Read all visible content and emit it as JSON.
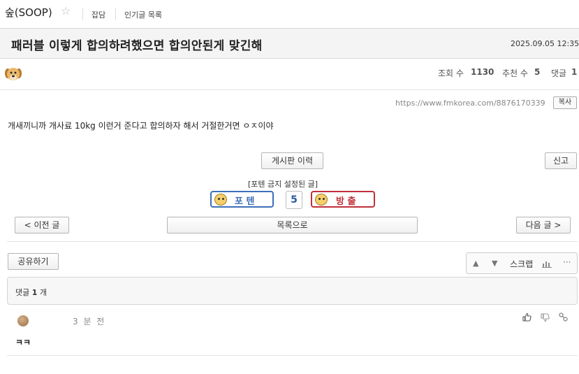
{
  "nav": {
    "site_name": "숲(SOOP)",
    "links": [
      "잡담",
      "인기글 목록"
    ]
  },
  "post": {
    "title": "패러블 이렇게 합의하려했으면 합의안된게 맞긴해",
    "date": "2025.09.05 12:35",
    "views_label": "조회 수",
    "views": "1130",
    "recommends_label": "추천 수",
    "recommends": "5",
    "comments_label": "댓글",
    "comments": "1",
    "source_url": "https://www.fmkorea.com/8876170339",
    "copy_label": "복사",
    "body": "개새끼니까 개사료 10kg 이런거 준다고 합의하자 해서 거절한거면 ㅇㅈ이야"
  },
  "actions": {
    "board_history": "게시판 이력",
    "report": "신고",
    "banned_note": "[포텐 금지 설정된 글]",
    "poten_label": "포 텐",
    "vote_count": "5",
    "bangchul_label": "방 출",
    "prev": "< 이전 글",
    "list": "목록으로",
    "next": "다음 글 >",
    "share": "공유하기",
    "scrap": "스크랩"
  },
  "comments_section": {
    "header_prefix": "댓글",
    "count": "1",
    "header_suffix": "개",
    "items": [
      {
        "time": "3 분 전",
        "text": "ㅋㅋ"
      }
    ]
  },
  "colors": {
    "poten": "#3d6fb8",
    "bangchul": "#c0303a"
  }
}
